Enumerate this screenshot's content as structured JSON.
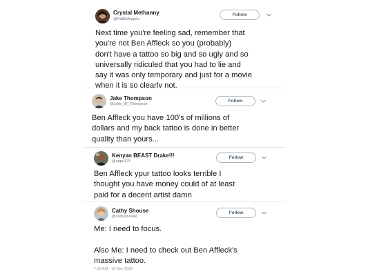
{
  "tweets": [
    {
      "name": "Crystal Methanny",
      "handle": "@RafiDiAngelo",
      "follow_label": "Follow",
      "text": "Next time you're feeling sad, remember that\nyou're not Ben Affleck so you (probably)\ndon't have a tattoo so big and so ugly and so\nuniversally ridiculed that you had to lie and\nsay it was only temporary and just for a movie\nwhen it is so clearly not."
    },
    {
      "name": "Jake Thompson",
      "handle": "@Jake_W_Thompson",
      "follow_label": "Follow",
      "text": "Ben Affleck you have 100's of millions of\ndollars and my back tattoo is done in better\nquality than yours..."
    },
    {
      "name": "Kenyan BEAST Drake!!!",
      "handle": "@eppo123",
      "follow_label": "Follow",
      "text": "Ben Affleck ypur tattoo looks terrible I\nthought you have money could of at least\npaid for a decent artist damn"
    },
    {
      "name": "Cathy Shouse",
      "handle": "@cathyshouse",
      "follow_label": "Follow",
      "text": "Me: I need to focus.\n\nAlso Me: I need to check out Ben Affleck's\nmassive tattoo.",
      "timestamp": "7:29 AM - 19 Mar 2018"
    }
  ],
  "icons": {
    "chevron": "chevron-down-icon"
  }
}
